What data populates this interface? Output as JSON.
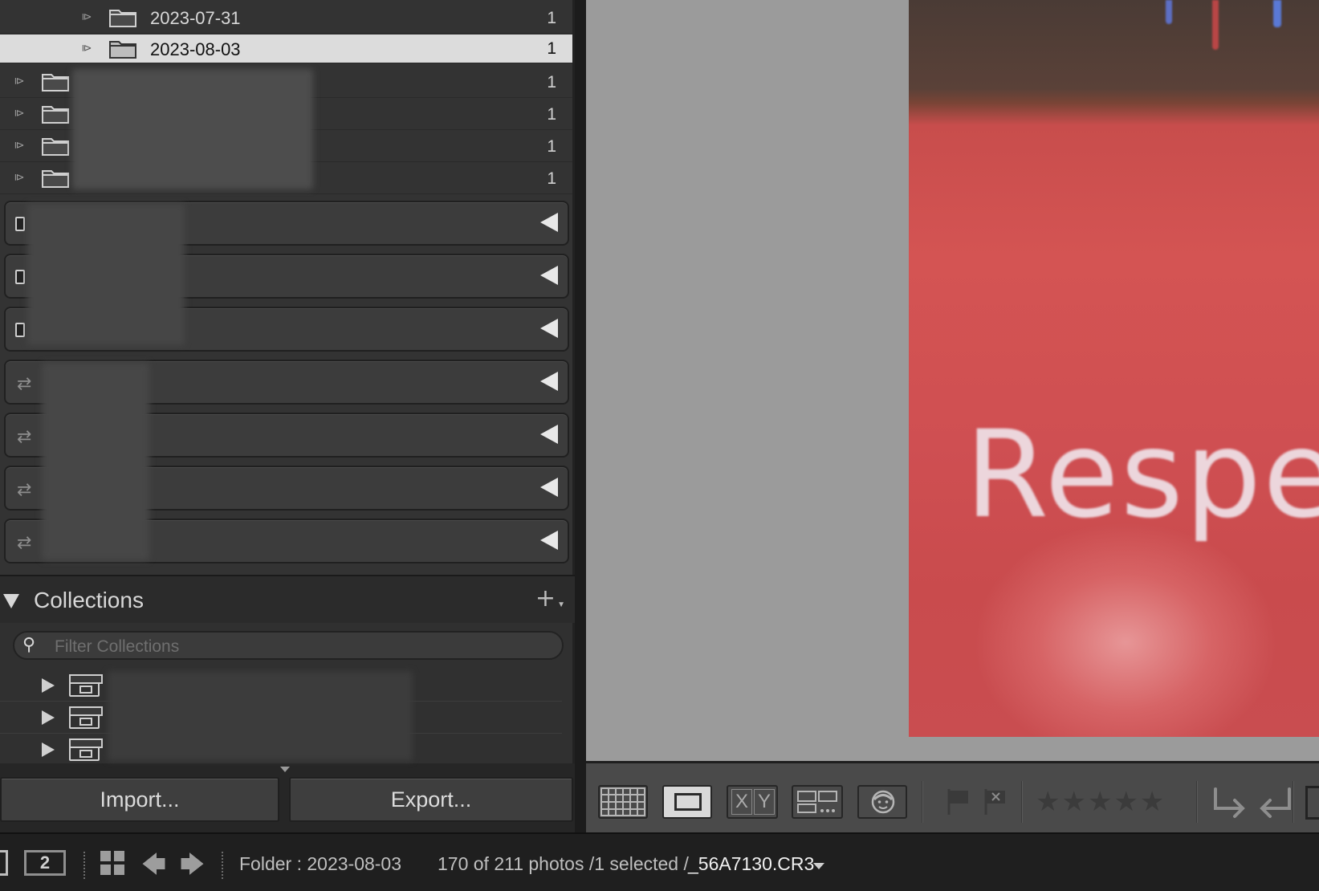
{
  "folders": {
    "subfolders": [
      {
        "name": "2023-07-31",
        "count": "1"
      },
      {
        "name": "2023-08-03",
        "count": "1",
        "selected": true
      }
    ],
    "redacted_folders": [
      {
        "count": "1"
      },
      {
        "count": "1"
      },
      {
        "count": "1"
      },
      {
        "count": "1"
      }
    ]
  },
  "collections": {
    "title": "Collections",
    "add_symbol": "+",
    "filter_placeholder": "Filter Collections"
  },
  "buttons": {
    "import": "Import...",
    "export": "Export..."
  },
  "photo": {
    "visible_text": "Respec"
  },
  "toolbar": {
    "compare_x": "X",
    "compare_y": "Y"
  },
  "filmstrip": {
    "secondary_display": "2",
    "folder_label": "Folder : 2023-08-03",
    "photo_count": "170 of 211 photos /1 selected /",
    "filename": "_56A7130.CR3"
  }
}
